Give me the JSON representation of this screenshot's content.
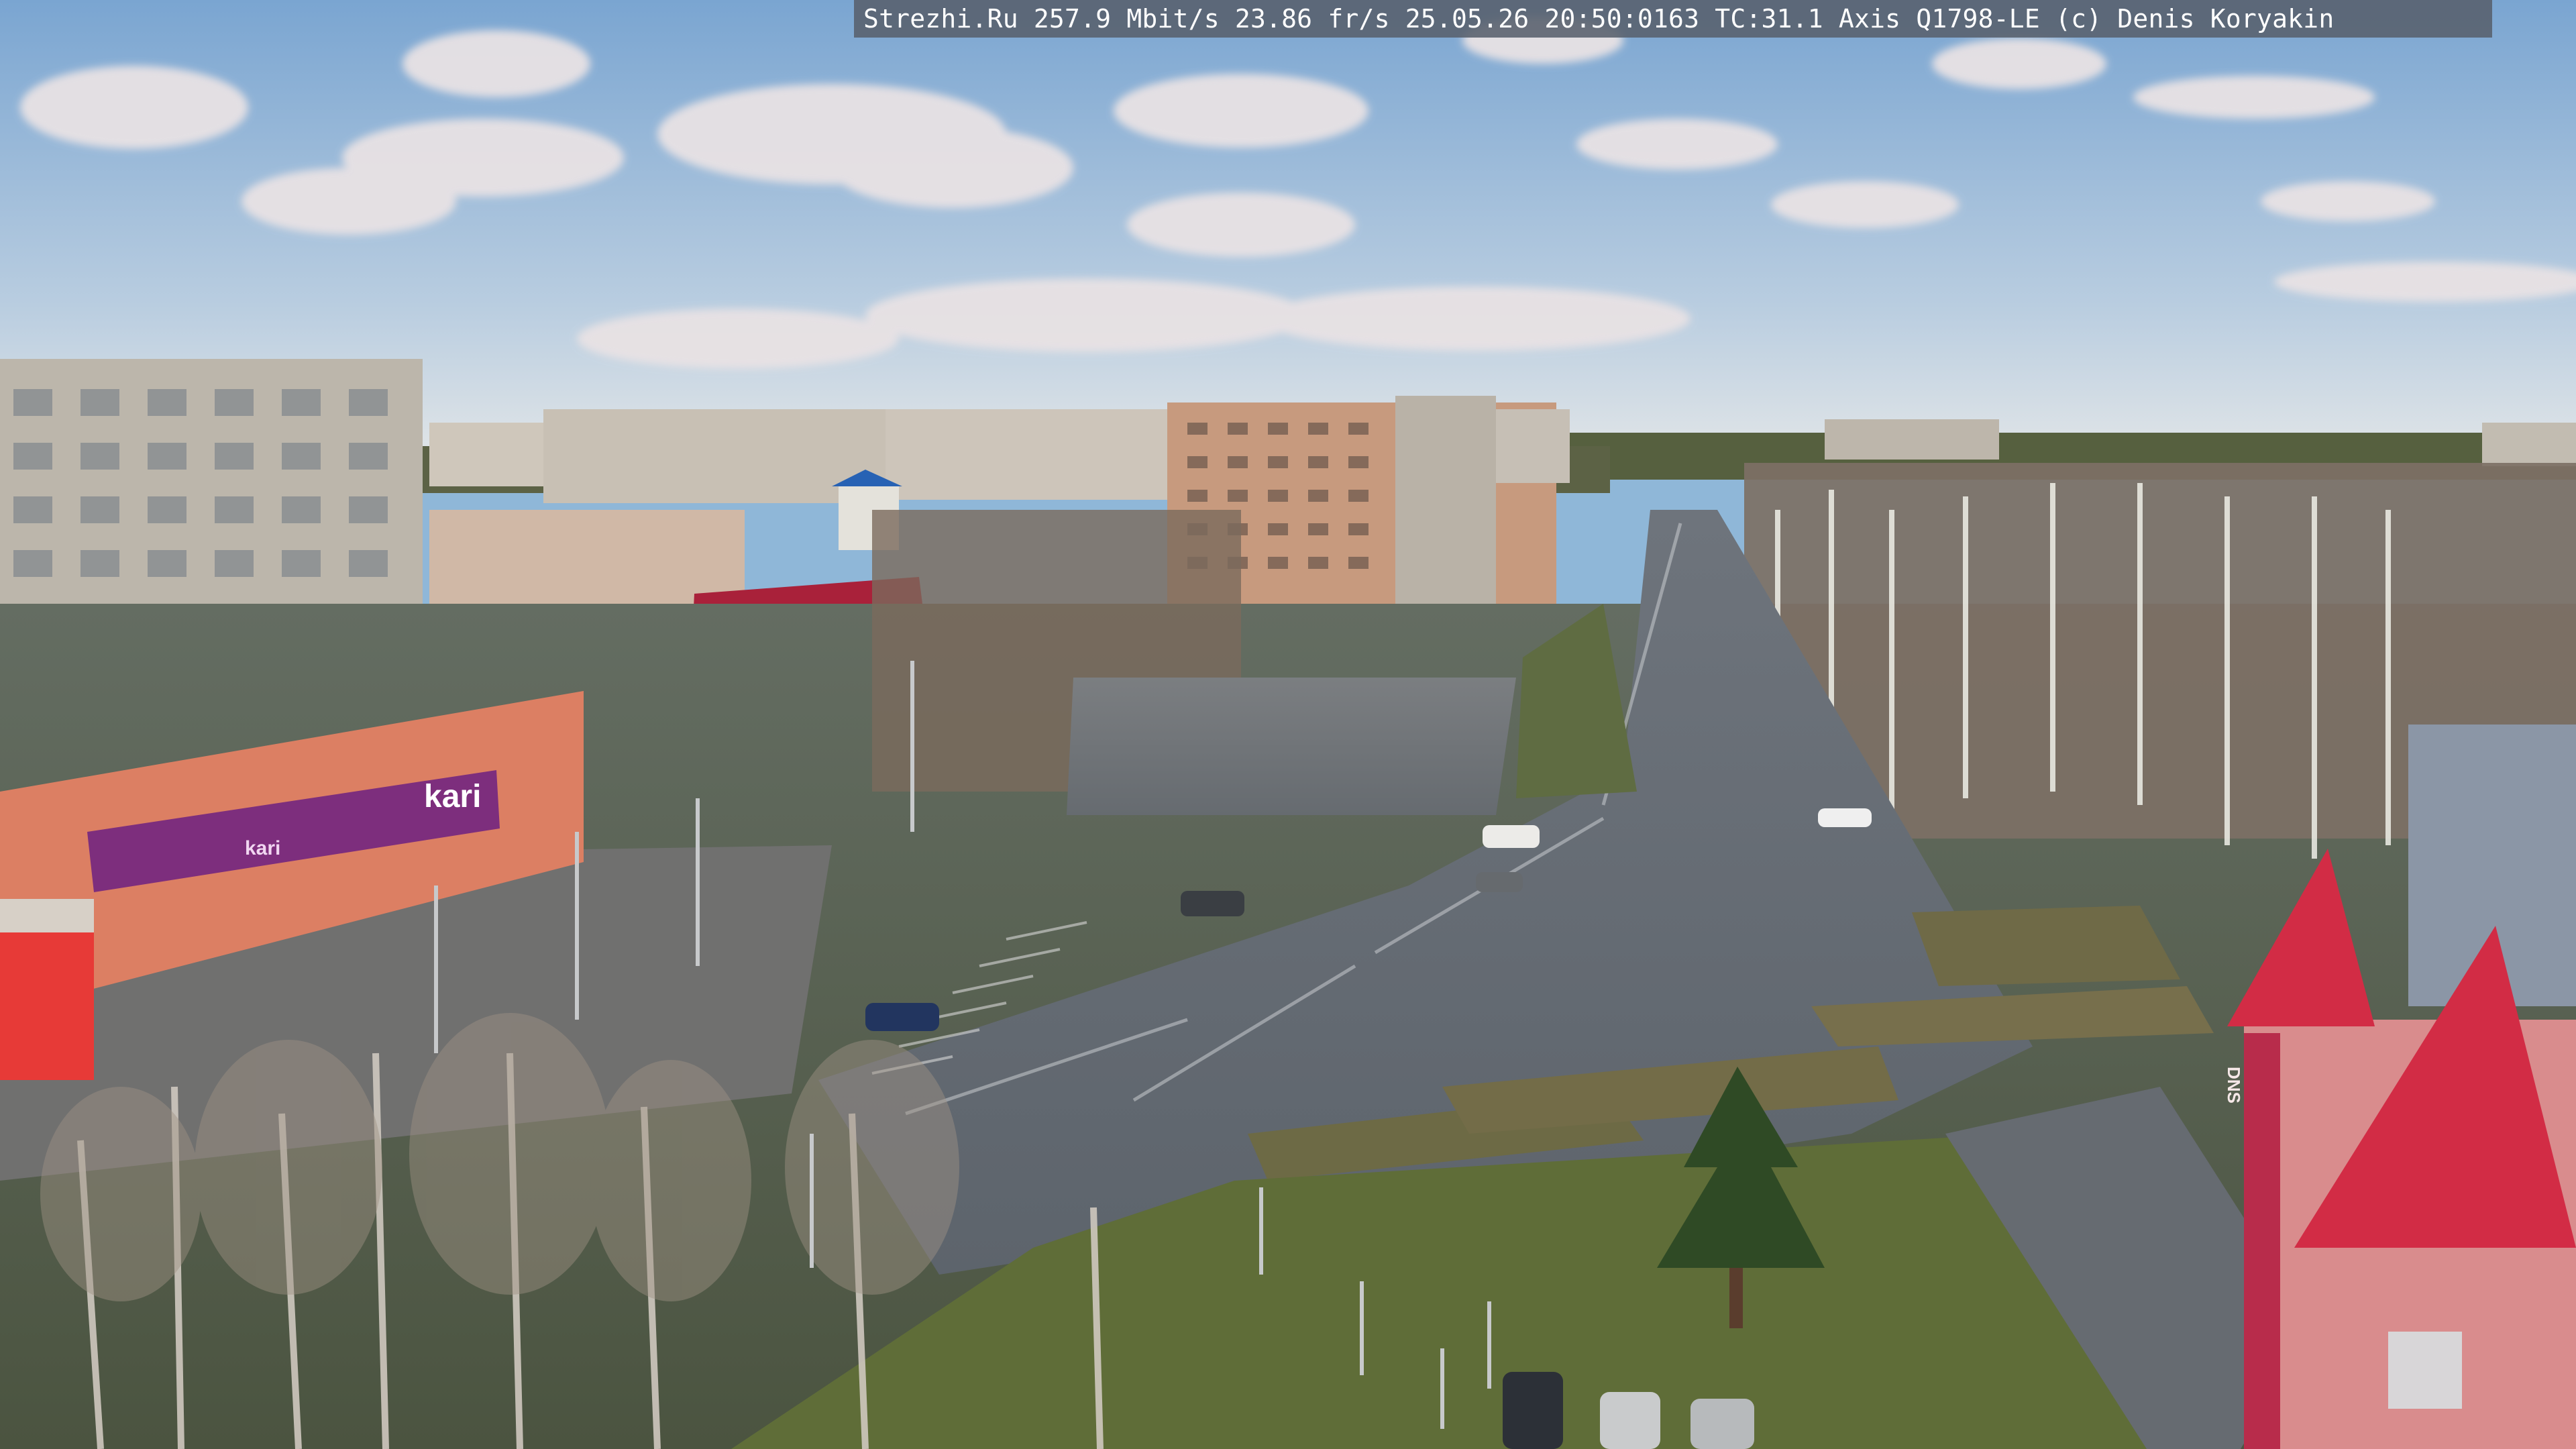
{
  "overlay": {
    "text": "Strezhi.Ru 257.9 Mbit/s 23.86 fr/s 25.05.26 20:50:0163 TC:31.1  Axis Q1798-LE  (c) Denis Koryakin"
  },
  "signs": {
    "store_left": "kari",
    "store_left_2": "kari",
    "store_right": "DNS"
  },
  "colors": {
    "sky_top": "#7fa9d4",
    "sky_bottom": "#d8e1ea",
    "brand_kari": "#7d2e7d",
    "roof_red": "#d22c45"
  }
}
